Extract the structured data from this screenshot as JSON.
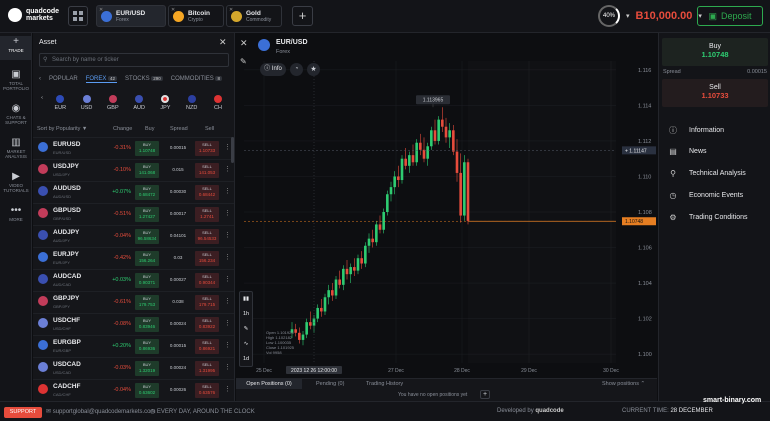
{
  "brand": {
    "logo_text_1": "quadcode",
    "logo_text_2": "markets"
  },
  "tabs": [
    {
      "name": "EUR/USD",
      "sub": "Forex",
      "color": "#3b6fd6"
    },
    {
      "name": "Bitcoin",
      "sub": "Crypto",
      "color": "#f5a623"
    },
    {
      "name": "Gold",
      "sub": "Commodity",
      "color": "#d4a72c"
    }
  ],
  "account": {
    "percent": "40%",
    "balance": "B10,000.00",
    "deposit": "Deposit"
  },
  "nav": [
    {
      "icon": "+",
      "label": "TRADE"
    },
    {
      "icon": "▣",
      "label": "TOTAL PORTFOLIO"
    },
    {
      "icon": "◉",
      "label": "CHATS & SUPPORT"
    },
    {
      "icon": "▥",
      "label": "MARKET ANALYSIS"
    },
    {
      "icon": "▶",
      "label": "VIDEO TUTORIALS"
    },
    {
      "icon": "•••",
      "label": "MORE"
    }
  ],
  "asset_panel": {
    "title": "Asset",
    "search_placeholder": "Search by name or ticker",
    "categories": [
      {
        "label": "POPULAR",
        "badge": ""
      },
      {
        "label": "FOREX",
        "badge": "42"
      },
      {
        "label": "STOCKS",
        "badge": "290"
      },
      {
        "label": "COMMODITIES",
        "badge": "8"
      }
    ],
    "currencies": [
      "EUR",
      "USD",
      "GBP",
      "AUD",
      "JPY",
      "NZD",
      "CH"
    ],
    "headers": [
      "Sort by Popularity ▼",
      "Change",
      "Buy",
      "Spread",
      "Sell"
    ],
    "buy_label": "BUY",
    "sell_label": "SELL",
    "rows": [
      {
        "sym": "EURUSD",
        "sub": "EUR/USD",
        "chg": "-0.31%",
        "buy": "1.10748",
        "spread": "0.00015",
        "sell": "1.10733"
      },
      {
        "sym": "USDJPY",
        "sub": "USD/JPY",
        "chg": "-0.10%",
        "buy": "141.068",
        "spread": "0.015",
        "sell": "141.053"
      },
      {
        "sym": "AUDUSD",
        "sub": "AUD/USD",
        "chg": "+0.07%",
        "buy": "0.68472",
        "spread": "0.00030",
        "sell": "0.68442"
      },
      {
        "sym": "GBPUSD",
        "sub": "GBP/USD",
        "chg": "-0.51%",
        "buy": "1.27427",
        "spread": "0.00017",
        "sell": "1.2741"
      },
      {
        "sym": "AUDJPY",
        "sub": "AUD/JPY",
        "chg": "-0.04%",
        "buy": "96.58634",
        "spread": "0.04101",
        "sell": "96.54533"
      },
      {
        "sym": "EURJPY",
        "sub": "EUR/JPY",
        "chg": "-0.42%",
        "buy": "156.264",
        "spread": "0.03",
        "sell": "156.234"
      },
      {
        "sym": "AUDCAD",
        "sub": "AUD/CAD",
        "chg": "+0.03%",
        "buy": "0.90371",
        "spread": "0.00027",
        "sell": "0.90344"
      },
      {
        "sym": "GBPJPY",
        "sub": "GBP/JPY",
        "chg": "-0.61%",
        "buy": "179.753",
        "spread": "0.038",
        "sell": "179.715"
      },
      {
        "sym": "USDCHF",
        "sub": "USD/CHF",
        "chg": "-0.08%",
        "buy": "0.83946",
        "spread": "0.00024",
        "sell": "0.83922"
      },
      {
        "sym": "EURGBP",
        "sub": "EUR/GBP",
        "chg": "+0.20%",
        "buy": "0.86936",
        "spread": "0.00015",
        "sell": "0.86921"
      },
      {
        "sym": "USDCAD",
        "sub": "USD/CAD",
        "chg": "-0.03%",
        "buy": "1.32019",
        "spread": "0.00024",
        "sell": "1.31995"
      },
      {
        "sym": "CADCHF",
        "sub": "CAD/CHF",
        "chg": "-0.04%",
        "buy": "0.63602",
        "spread": "0.00026",
        "sell": "0.63576"
      }
    ]
  },
  "chart": {
    "pair": "EUR/USD",
    "market": "Forex",
    "info_label": "Info",
    "y_ticks": [
      "1.116",
      "1.114",
      "1.112",
      "1.110",
      "1.108",
      "1.106",
      "1.104",
      "1.102",
      "1.100"
    ],
    "x_ticks": [
      "25 Dec",
      "2023 12 26 12:00:00",
      "27 Dec",
      "28 Dec",
      "29 Dec",
      "30 Dec"
    ],
    "high_label": "1.113965",
    "current_price": "1.11147",
    "last_price": "1.10748",
    "ohlc": [
      "Open 1.101925",
      "High 1.102182",
      "Low 1.100035",
      "Close 1.101925",
      "Vol 9958"
    ],
    "tools": [
      "1h",
      "1d"
    ],
    "colors": {
      "up": "#2ecc71",
      "down": "#e74c3c",
      "last": "#e67e22"
    }
  },
  "chart_data": {
    "type": "candlestick",
    "x_labels": [
      "25 Dec",
      "26 Dec",
      "27 Dec",
      "28 Dec",
      "29 Dec",
      "30 Dec"
    ],
    "ylim": [
      1.0995,
      1.1165
    ],
    "candles": [
      [
        1.1012,
        1.1018,
        1.1009,
        1.1014
      ],
      [
        1.1014,
        1.1017,
        1.101,
        1.1012
      ],
      [
        1.1012,
        1.1015,
        1.1006,
        1.1008
      ],
      [
        1.1008,
        1.1013,
        1.1005,
        1.1011
      ],
      [
        1.1011,
        1.102,
        1.1009,
        1.1018
      ],
      [
        1.1018,
        1.1024,
        1.1014,
        1.1016
      ],
      [
        1.1016,
        1.1022,
        1.1012,
        1.102
      ],
      [
        1.102,
        1.1028,
        1.1018,
        1.1026
      ],
      [
        1.1026,
        1.1031,
        1.1021,
        1.1024
      ],
      [
        1.1024,
        1.1034,
        1.1022,
        1.1032
      ],
      [
        1.1032,
        1.1039,
        1.1028,
        1.1036
      ],
      [
        1.1036,
        1.104,
        1.103,
        1.1033
      ],
      [
        1.1033,
        1.1044,
        1.1031,
        1.1042
      ],
      [
        1.1042,
        1.1047,
        1.1037,
        1.1039
      ],
      [
        1.1039,
        1.105,
        1.1036,
        1.1048
      ],
      [
        1.1048,
        1.1053,
        1.1042,
        1.1045
      ],
      [
        1.1045,
        1.1051,
        1.104,
        1.1049
      ],
      [
        1.1049,
        1.1054,
        1.1044,
        1.1047
      ],
      [
        1.1047,
        1.1056,
        1.1045,
        1.1054
      ],
      [
        1.1054,
        1.1058,
        1.1048,
        1.1051
      ],
      [
        1.1051,
        1.1063,
        1.1049,
        1.1061
      ],
      [
        1.1061,
        1.1068,
        1.1057,
        1.1065
      ],
      [
        1.1065,
        1.107,
        1.106,
        1.1063
      ],
      [
        1.1063,
        1.1075,
        1.1061,
        1.1073
      ],
      [
        1.1073,
        1.1078,
        1.1068,
        1.107
      ],
      [
        1.107,
        1.1082,
        1.1068,
        1.108
      ],
      [
        1.108,
        1.1092,
        1.1078,
        1.109
      ],
      [
        1.109,
        1.1097,
        1.1086,
        1.1094
      ],
      [
        1.1094,
        1.1103,
        1.109,
        1.11
      ],
      [
        1.11,
        1.1106,
        1.1094,
        1.1098
      ],
      [
        1.1098,
        1.1112,
        1.1096,
        1.111
      ],
      [
        1.111,
        1.1116,
        1.1104,
        1.1106
      ],
      [
        1.1106,
        1.1114,
        1.1102,
        1.1112
      ],
      [
        1.1112,
        1.1118,
        1.1106,
        1.1108
      ],
      [
        1.1108,
        1.1121,
        1.1106,
        1.1119
      ],
      [
        1.1119,
        1.1124,
        1.1112,
        1.1115
      ],
      [
        1.1115,
        1.1122,
        1.1108,
        1.111
      ],
      [
        1.111,
        1.1119,
        1.1106,
        1.1117
      ],
      [
        1.1117,
        1.1128,
        1.1115,
        1.1126
      ],
      [
        1.1126,
        1.1132,
        1.1118,
        1.112
      ],
      [
        1.112,
        1.1134,
        1.1118,
        1.1132
      ],
      [
        1.1132,
        1.1139,
        1.1125,
        1.1128
      ],
      [
        1.1128,
        1.1133,
        1.1119,
        1.1122
      ],
      [
        1.1122,
        1.113,
        1.1116,
        1.1126
      ],
      [
        1.1126,
        1.1129,
        1.1112,
        1.1114
      ],
      [
        1.1114,
        1.1121,
        1.1097,
        1.1102
      ],
      [
        1.1102,
        1.1113,
        1.1074,
        1.1078
      ],
      [
        1.1078,
        1.1112,
        1.1075,
        1.1108
      ],
      [
        1.1108,
        1.111,
        1.1073,
        1.1075
      ]
    ]
  },
  "bottom": {
    "tabs": [
      "Open Positions (0)",
      "Pending (0)",
      "Trading History"
    ],
    "show": "Show positions",
    "empty": "You have no open positions yet"
  },
  "rpanel": {
    "buy": "Buy",
    "buy_price": "1.10748",
    "spread": "Spread",
    "spread_val": "0.00015",
    "sell": "Sell",
    "sell_price": "1.10733",
    "menu": [
      {
        "icon": "ⓘ",
        "label": "Information"
      },
      {
        "icon": "▤",
        "label": "News"
      },
      {
        "icon": "⚲",
        "label": "Technical Analysis"
      },
      {
        "icon": "◷",
        "label": "Economic Events"
      },
      {
        "icon": "⚙",
        "label": "Trading Conditions"
      }
    ]
  },
  "footer": {
    "support": "SUPPORT",
    "email": "supportglobal@quadcodemarkets.com",
    "hours": "EVERY DAY, AROUND THE CLOCK",
    "dev": "Developed by",
    "dev2": "quadcode",
    "time_label": "CURRENT TIME:",
    "time": "28 DECEMBER",
    "watermark": "smart-binary.com"
  }
}
